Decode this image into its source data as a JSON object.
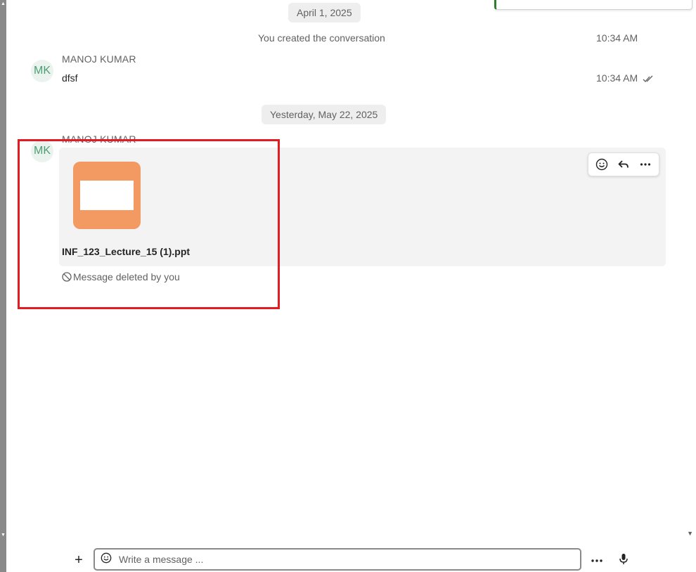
{
  "thread": {
    "date_1": "April 1, 2025",
    "system_message": "You created the conversation",
    "system_time": "10:34 AM",
    "message_1": {
      "avatar_initials": "MK",
      "sender": "MANOJ KUMAR",
      "text": "dfsf",
      "time": "10:34 AM",
      "status_icon": "double-check-icon"
    },
    "date_2": "Yesterday, May 22, 2025",
    "message_2": {
      "avatar_initials": "MK",
      "sender": "MANOJ KUMAR",
      "attachment_icon": "ppt-file-icon",
      "attachment_name": "INF_123_Lecture_15 (1).ppt",
      "deleted_note": "Message deleted by you",
      "deleted_icon": "blocked-circle-icon",
      "actions": [
        "emoji-react-icon",
        "reply-icon",
        "more-icon"
      ]
    }
  },
  "composer": {
    "add_icon": "+",
    "placeholder": "Write a message ...",
    "emoji_icon": "emoji-icon",
    "more_icon": "more-icon",
    "mic_icon": "microphone-icon"
  },
  "colors": {
    "ppt_icon": "#f29a62",
    "avatar_bg": "#eaf3ee",
    "avatar_text": "#4d9e74",
    "highlight": "#e31b23"
  }
}
